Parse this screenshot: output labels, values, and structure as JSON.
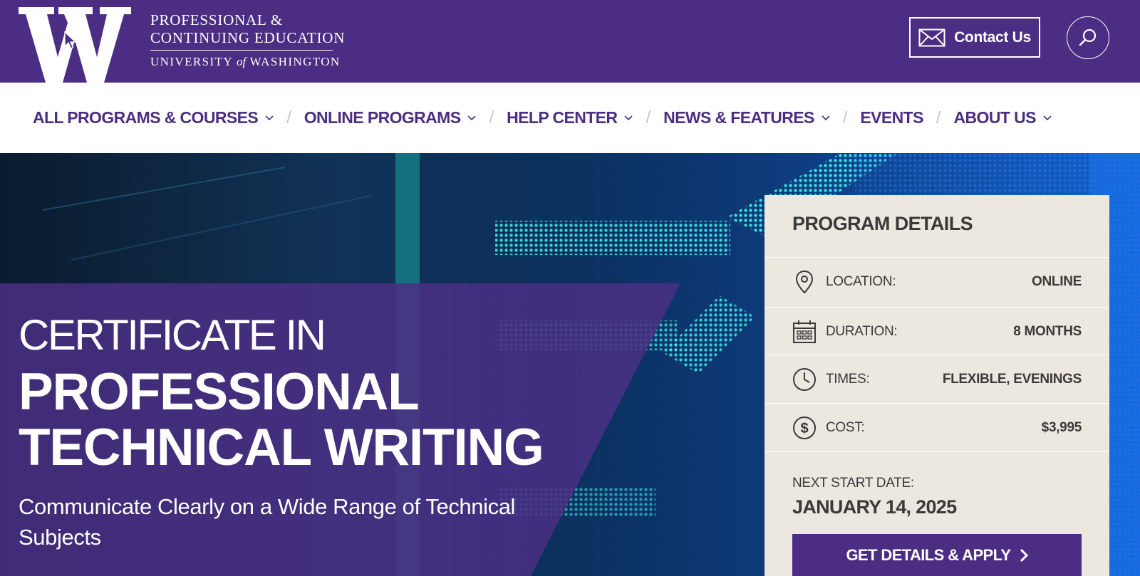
{
  "header": {
    "logo_line1": "PROFESSIONAL &",
    "logo_line2": "CONTINUING EDUCATION",
    "logo_line3_pre": "UNIVERSITY ",
    "logo_line3_of": "of",
    "logo_line3_post": " WASHINGTON",
    "contact_label": "Contact Us"
  },
  "nav": {
    "items": [
      {
        "label": "ALL PROGRAMS & COURSES"
      },
      {
        "label": "ONLINE PROGRAMS"
      },
      {
        "label": "HELP CENTER"
      },
      {
        "label": "NEWS & FEATURES"
      },
      {
        "label": "EVENTS"
      },
      {
        "label": "ABOUT US"
      }
    ],
    "separator": "/"
  },
  "hero": {
    "pretitle": "CERTIFICATE IN",
    "title_line1": "PROFESSIONAL",
    "title_line2": "TECHNICAL WRITING",
    "subtitle": "Communicate Clearly on a Wide Range of Technical Subjects"
  },
  "program_details": {
    "title": "PROGRAM DETAILS",
    "rows": [
      {
        "label": "LOCATION:",
        "value": "ONLINE",
        "icon": "location-pin-icon"
      },
      {
        "label": "DURATION:",
        "value": "8 MONTHS",
        "icon": "calendar-icon"
      },
      {
        "label": "TIMES:",
        "value": "FLEXIBLE, EVENINGS",
        "icon": "clock-icon"
      },
      {
        "label": "COST:",
        "value": "$3,995",
        "icon": "dollar-icon"
      }
    ],
    "next_start_label": "NEXT START DATE:",
    "next_start_date": "JANUARY 14, 2025",
    "apply_label": "GET DETAILS & APPLY"
  },
  "colors": {
    "brand_purple": "#4b2e83",
    "card_bg": "#ece8df",
    "text_dark": "#3a3a3a"
  }
}
